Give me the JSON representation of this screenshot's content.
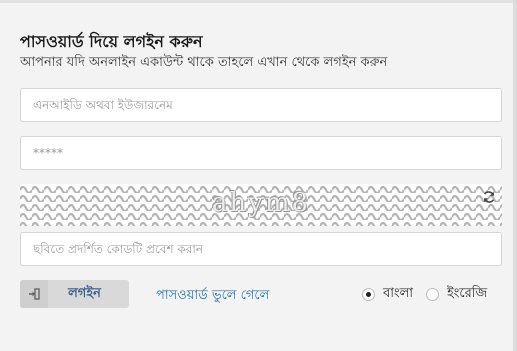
{
  "header": {
    "title": "পাসওয়ার্ড দিয়ে লগইন করুন",
    "subtitle": "আপনার যদি অনলাইন একাউন্ট থাকে তাহলে এখান থেকে লগইন করুন"
  },
  "form": {
    "username_placeholder": "এনআইডি অথবা ইউজারনেম",
    "password_placeholder": "*****",
    "captcha_text": "ahym8",
    "captcha_placeholder": "ছবিতে প্রদর্শিত কোডটি প্রবেশ করান"
  },
  "actions": {
    "login_label": "লগইন",
    "forgot_label": "পাসওয়ার্ড ভুলে গেলে"
  },
  "language": {
    "selected": "বাংলা",
    "options": [
      {
        "label": "বাংলা",
        "checked": true
      },
      {
        "label": "ইংরেজি",
        "checked": false
      }
    ]
  },
  "icons": {
    "login": "sign-in-icon",
    "refresh": "refresh-icon"
  },
  "colors": {
    "link": "#1f6fa8",
    "button_text": "#3a5f8a",
    "button_bg": "#d9d9d9"
  }
}
